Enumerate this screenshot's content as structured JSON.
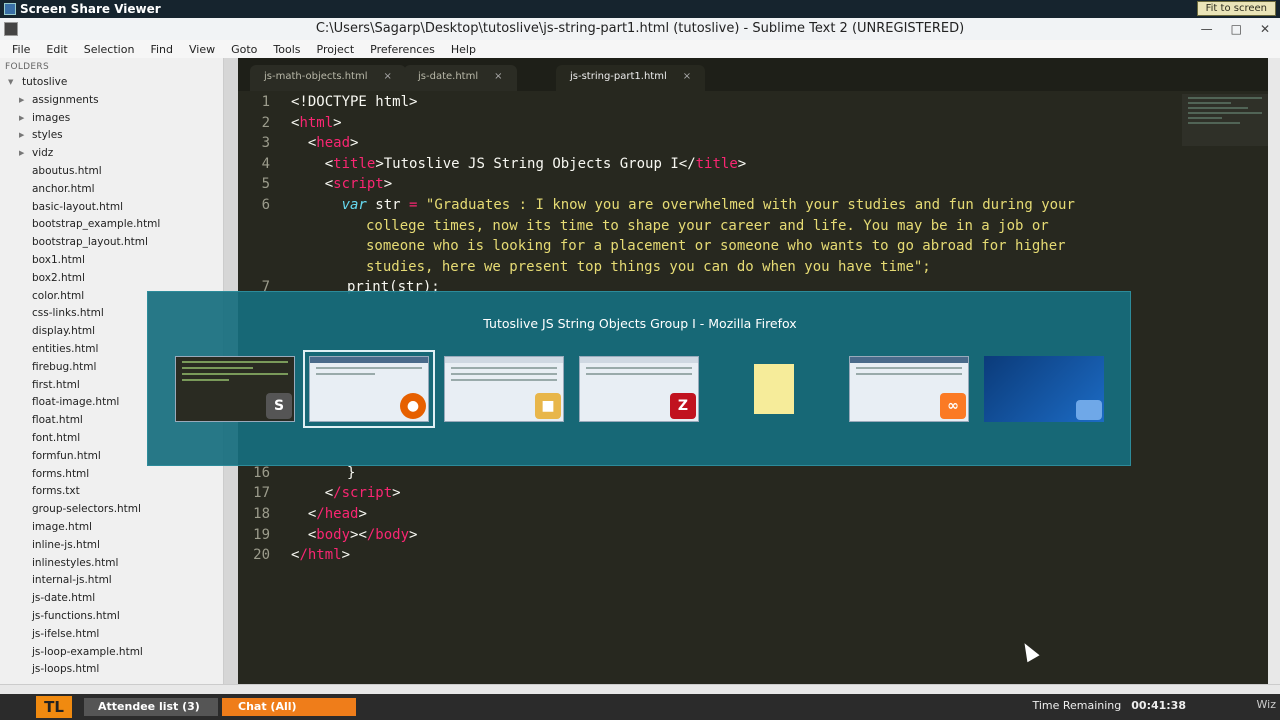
{
  "viewer": {
    "title": "Screen Share Viewer",
    "fit_label": "Fit to screen"
  },
  "window": {
    "title": "C:\\Users\\Sagarp\\Desktop\\tutoslive\\js-string-part1.html (tutoslive) - Sublime Text 2 (UNREGISTERED)"
  },
  "menu": [
    "File",
    "Edit",
    "Selection",
    "Find",
    "View",
    "Goto",
    "Tools",
    "Project",
    "Preferences",
    "Help"
  ],
  "sidebar": {
    "header": "FOLDERS",
    "root": "tutoslive",
    "folders": [
      "assignments",
      "images",
      "styles",
      "vidz"
    ],
    "files": [
      "aboutus.html",
      "anchor.html",
      "basic-layout.html",
      "bootstrap_example.html",
      "bootstrap_layout.html",
      "box1.html",
      "box2.html",
      "color.html",
      "css-links.html",
      "display.html",
      "entities.html",
      "firebug.html",
      "first.html",
      "float-image.html",
      "float.html",
      "font.html",
      "formfun.html",
      "forms.html",
      "forms.txt",
      "group-selectors.html",
      "image.html",
      "inline-js.html",
      "inlinestyles.html",
      "internal-js.html",
      "js-date.html",
      "js-functions.html",
      "js-ifelse.html",
      "js-loop-example.html",
      "js-loops.html"
    ]
  },
  "tabs": [
    {
      "label": "js-math-objects.html",
      "close": "×"
    },
    {
      "label": "js-date.html",
      "close": "×"
    },
    {
      "label": "js-string-part1.html",
      "close": "×"
    }
  ],
  "code": {
    "l1": "1",
    "l2": "2",
    "l3": "3",
    "l4": "4",
    "l5": "5",
    "l6": "6",
    "l7": "7",
    "l16": "16",
    "l17": "17",
    "l18": "18",
    "l19": "19",
    "l20": "20",
    "doctype": "<!DOCTYPE html>",
    "html_open": "html",
    "head_open": "head",
    "title_tag": "title",
    "title_text": "Tutoslive JS String Objects Group I",
    "script_tag": "script",
    "var_kw": "var",
    "var_name": " str ",
    "eq": "=",
    "str1": " \"Graduates : I know you are overwhelmed with your studies and fun during your",
    "str2": "college times, now its time to shape your career and life. You may be in a job or",
    "str3": "someone who is looking for a placement or someone who wants to go abroad for higher",
    "str4": "studies, here we present top things you can do when you have time\";",
    "print": "print(str);",
    "brace": "}",
    "script_close": "/script",
    "head_close": "/head",
    "body_tag": "body",
    "body_close": "/body",
    "html_close": "/html"
  },
  "switcher": {
    "window_title": "Tutoslive JS String Objects Group I - Mozilla Firefox"
  },
  "taskbar": {
    "logo": "TL",
    "attendee": "Attendee list (3)",
    "chat": "Chat (All)",
    "time_label": "Time Remaining",
    "time_value": "00:41:38",
    "brand": "Wiz"
  }
}
